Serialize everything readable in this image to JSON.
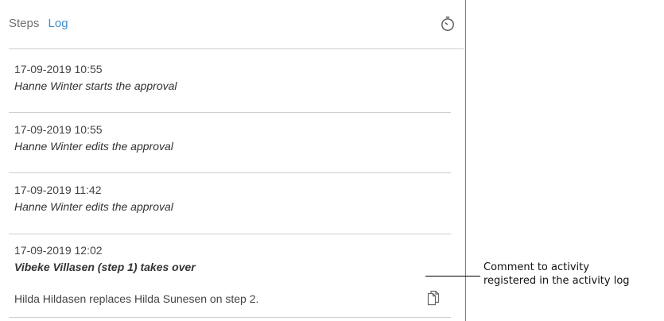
{
  "tabs": {
    "steps": "Steps",
    "log": "Log",
    "active": "log"
  },
  "header_icon": "timer-icon",
  "log": [
    {
      "timestamp": "17-09-2019 10:55",
      "activity": "Hanne Winter starts the approval"
    },
    {
      "timestamp": "17-09-2019 10:55",
      "activity": "Hanne Winter edits the approval"
    },
    {
      "timestamp": "17-09-2019 11:42",
      "activity": "Hanne Winter edits the approval"
    },
    {
      "timestamp": "17-09-2019 12:02",
      "activity": "Vibeke Villasen (step 1) takes over",
      "comment": "Hilda Hildasen replaces Hilda Sunesen on step 2.",
      "comment_icon": "copy-icon"
    }
  ],
  "callout": {
    "line1": "Comment to activity",
    "line2": "registered in the activity log"
  },
  "colors": {
    "accent": "#3a8fd4",
    "divider": "#cfcfcf"
  }
}
